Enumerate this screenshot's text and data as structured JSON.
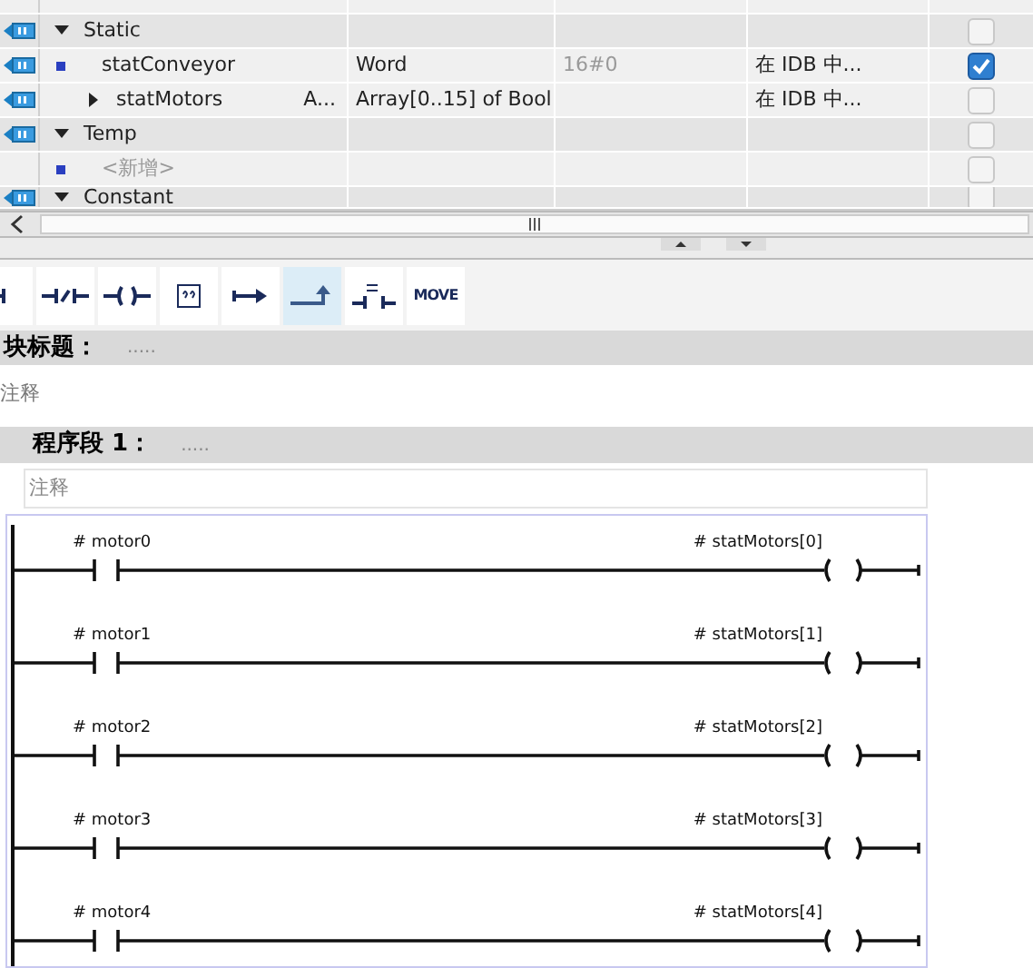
{
  "table": {
    "rows": [
      {
        "kind": "blank"
      },
      {
        "kind": "section",
        "name": "Static",
        "expanded": true,
        "checked": false
      },
      {
        "kind": "var",
        "name": "statConveyor",
        "type": "Word",
        "default": "16#0",
        "access": "在 IDB 中...",
        "checked": true
      },
      {
        "kind": "array",
        "name": "statMotors",
        "extra": "A...",
        "type": "Array[0..15] of Bool",
        "access": "在 IDB 中...",
        "expanded": false,
        "checked": false
      },
      {
        "kind": "section",
        "name": "Temp",
        "expanded": true,
        "checked": false
      },
      {
        "kind": "add",
        "name": "<新增>",
        "checked": false
      },
      {
        "kind": "section",
        "name": "Constant",
        "expanded": true,
        "checked": false
      }
    ]
  },
  "toolbar": [
    {
      "kind": "contact",
      "selected": false
    },
    {
      "kind": "nc",
      "selected": false
    },
    {
      "kind": "coil",
      "selected": false
    },
    {
      "kind": "box",
      "selected": false
    },
    {
      "kind": "open",
      "selected": false
    },
    {
      "kind": "close",
      "selected": true
    },
    {
      "kind": "compare",
      "selected": false
    },
    {
      "kind": "text",
      "label": "MOVE",
      "selected": false
    }
  ],
  "block": {
    "title": "块标题：",
    "dots": ".....",
    "comment": "注释"
  },
  "network": {
    "title": "程序段 1：",
    "dots": ".....",
    "comment": "注释",
    "rungs": [
      {
        "contact": "# motor0",
        "coil": "# statMotors[0]"
      },
      {
        "contact": "# motor1",
        "coil": "# statMotors[1]"
      },
      {
        "contact": "# motor2",
        "coil": "# statMotors[2]"
      },
      {
        "contact": "# motor3",
        "coil": "# statMotors[3]"
      },
      {
        "contact": "# motor4",
        "coil": "# statMotors[4]"
      }
    ]
  }
}
